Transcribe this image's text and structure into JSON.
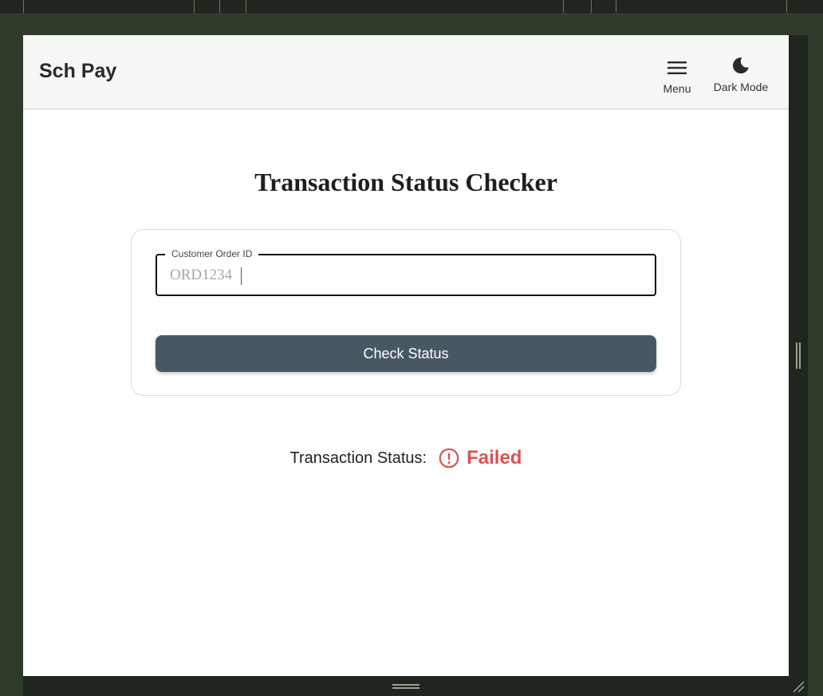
{
  "app": {
    "brand": "Sch Pay",
    "menu_label": "Menu",
    "dark_mode_label": "Dark Mode"
  },
  "page": {
    "title": "Transaction Status Checker"
  },
  "form": {
    "order_id_label": "Customer Order ID",
    "order_id_placeholder": "ORD1234",
    "order_id_value": "",
    "submit_label": "Check Status"
  },
  "result": {
    "label": "Transaction Status:",
    "status": "Failed",
    "status_icon": "error-circle-icon",
    "status_color": "#d9534f"
  },
  "colors": {
    "button_bg": "#485863",
    "header_bg": "#f7f7f7",
    "frame_bg": "#2e3b2b"
  }
}
